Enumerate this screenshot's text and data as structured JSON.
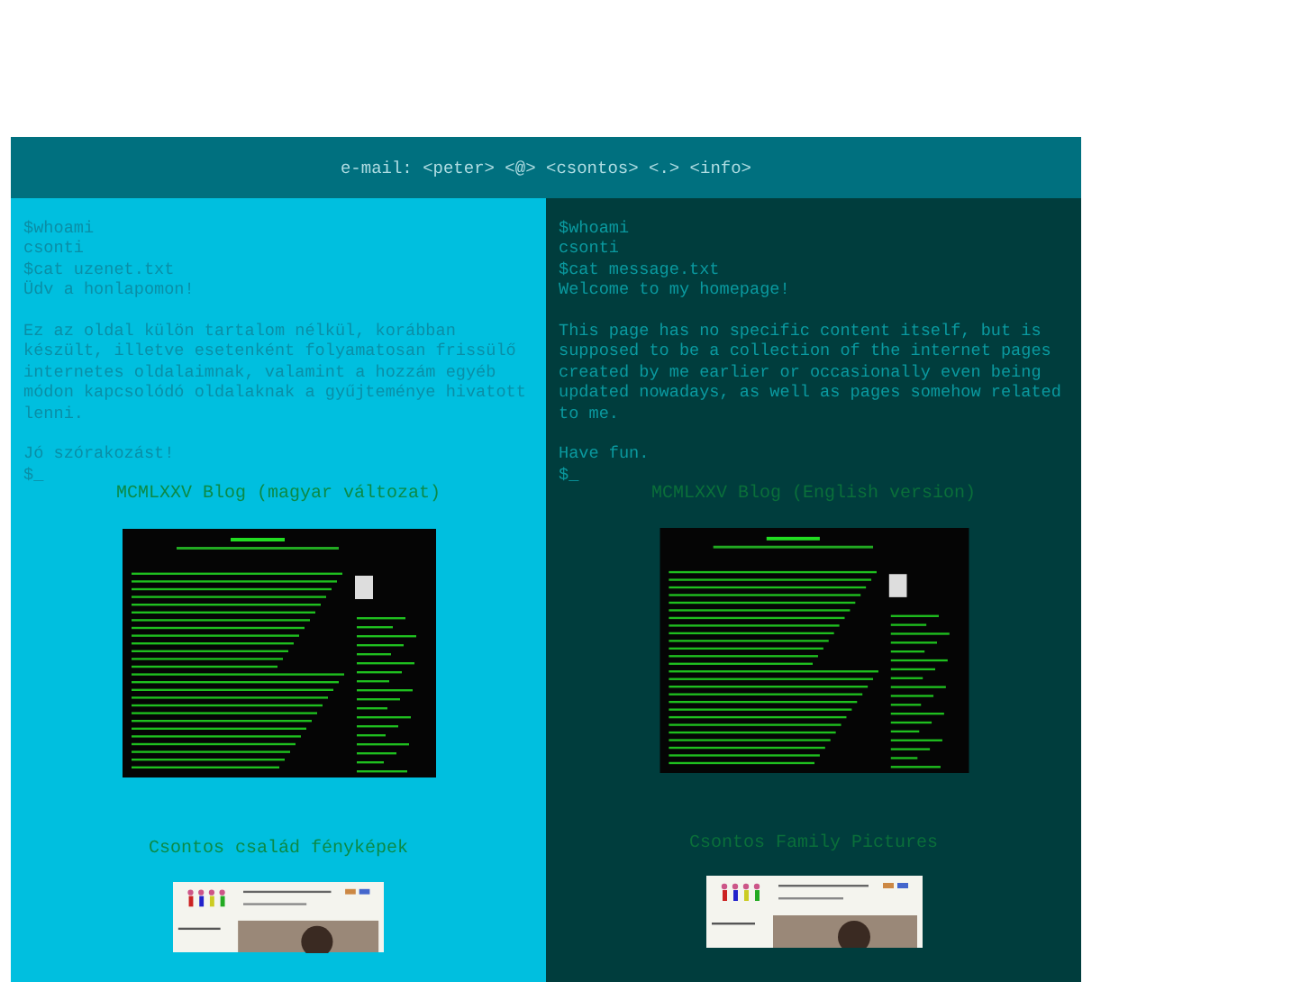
{
  "header": {
    "email": "e-mail: <peter> <@> <csontos> <.> <info>"
  },
  "columns": [
    {
      "lines": [
        "$whoami",
        "csonti",
        "$cat uzenet.txt",
        "Üdv a honlapomon!"
      ],
      "paragraph": "Ez az oldal külön tartalom nélkül, korábban készült, illetve esetenként folyamatosan frissülő internetes oldalaimnak, valamint a hozzám egyéb módon kapcsolódó oldalaknak a gyűjteménye hivatott lenni.",
      "closing": "Jó szórakozást!",
      "prompt": "$_",
      "links": [
        {
          "label": "MCMLXXV Blog (magyar változat)",
          "kind": "blog"
        },
        {
          "label": "Csontos család fényképek",
          "kind": "family"
        }
      ]
    },
    {
      "lines": [
        "$whoami",
        "csonti",
        "$cat message.txt",
        "Welcome to my homepage!"
      ],
      "paragraph": "This page has no specific content itself, but is supposed to be a collection of the internet pages created by me earlier or occasionally even being updated nowadays, as well as pages somehow related to me.",
      "closing": "Have fun.",
      "prompt": "$_",
      "links": [
        {
          "label": "MCMLXXV Blog (English version)",
          "kind": "blog"
        },
        {
          "label": "Csontos Family Pictures",
          "kind": "family"
        }
      ]
    }
  ]
}
